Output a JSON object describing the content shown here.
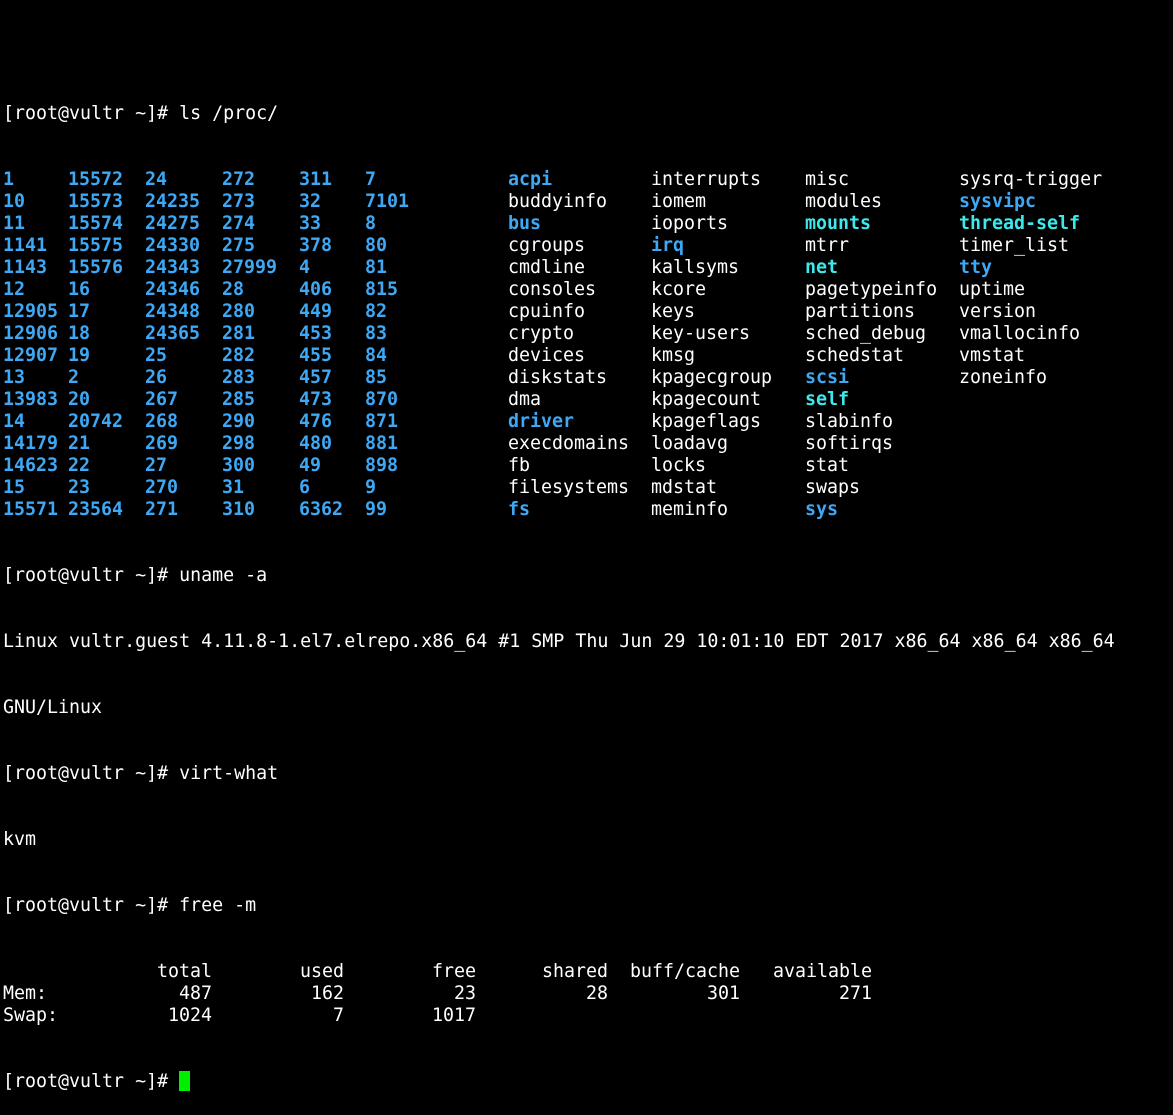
{
  "terminal": {
    "prompt": "[root@vultr ~]# ",
    "cutoff_line": "",
    "commands": {
      "ls": "ls /proc/",
      "uname": "uname -a",
      "virt": "virt-what",
      "free": "free -m"
    },
    "ls_rows": [
      [
        {
          "t": "1",
          "k": "num"
        },
        {
          "t": "15572",
          "k": "num"
        },
        {
          "t": "24",
          "k": "num"
        },
        {
          "t": "272",
          "k": "num"
        },
        {
          "t": "311",
          "k": "num"
        },
        {
          "t": "7",
          "k": "num"
        },
        {
          "t": "acpi",
          "k": "dir"
        },
        {
          "t": "interrupts",
          "k": "file"
        },
        {
          "t": "misc",
          "k": "file"
        },
        {
          "t": "sysrq-trigger",
          "k": "file"
        }
      ],
      [
        {
          "t": "10",
          "k": "num"
        },
        {
          "t": "15573",
          "k": "num"
        },
        {
          "t": "24235",
          "k": "num"
        },
        {
          "t": "273",
          "k": "num"
        },
        {
          "t": "32",
          "k": "num"
        },
        {
          "t": "7101",
          "k": "num"
        },
        {
          "t": "buddyinfo",
          "k": "file"
        },
        {
          "t": "iomem",
          "k": "file"
        },
        {
          "t": "modules",
          "k": "file"
        },
        {
          "t": "sysvipc",
          "k": "dir"
        }
      ],
      [
        {
          "t": "11",
          "k": "num"
        },
        {
          "t": "15574",
          "k": "num"
        },
        {
          "t": "24275",
          "k": "num"
        },
        {
          "t": "274",
          "k": "num"
        },
        {
          "t": "33",
          "k": "num"
        },
        {
          "t": "8",
          "k": "num"
        },
        {
          "t": "bus",
          "k": "dir"
        },
        {
          "t": "ioports",
          "k": "file"
        },
        {
          "t": "mounts",
          "k": "link"
        },
        {
          "t": "thread-self",
          "k": "link"
        }
      ],
      [
        {
          "t": "1141",
          "k": "num"
        },
        {
          "t": "15575",
          "k": "num"
        },
        {
          "t": "24330",
          "k": "num"
        },
        {
          "t": "275",
          "k": "num"
        },
        {
          "t": "378",
          "k": "num"
        },
        {
          "t": "80",
          "k": "num"
        },
        {
          "t": "cgroups",
          "k": "file"
        },
        {
          "t": "irq",
          "k": "dir"
        },
        {
          "t": "mtrr",
          "k": "file"
        },
        {
          "t": "timer_list",
          "k": "file"
        }
      ],
      [
        {
          "t": "1143",
          "k": "num"
        },
        {
          "t": "15576",
          "k": "num"
        },
        {
          "t": "24343",
          "k": "num"
        },
        {
          "t": "27999",
          "k": "num"
        },
        {
          "t": "4",
          "k": "num"
        },
        {
          "t": "81",
          "k": "num"
        },
        {
          "t": "cmdline",
          "k": "file"
        },
        {
          "t": "kallsyms",
          "k": "file"
        },
        {
          "t": "net",
          "k": "link"
        },
        {
          "t": "tty",
          "k": "dir"
        }
      ],
      [
        {
          "t": "12",
          "k": "num"
        },
        {
          "t": "16",
          "k": "num"
        },
        {
          "t": "24346",
          "k": "num"
        },
        {
          "t": "28",
          "k": "num"
        },
        {
          "t": "406",
          "k": "num"
        },
        {
          "t": "815",
          "k": "num"
        },
        {
          "t": "consoles",
          "k": "file"
        },
        {
          "t": "kcore",
          "k": "file"
        },
        {
          "t": "pagetypeinfo",
          "k": "file"
        },
        {
          "t": "uptime",
          "k": "file"
        }
      ],
      [
        {
          "t": "12905",
          "k": "num"
        },
        {
          "t": "17",
          "k": "num"
        },
        {
          "t": "24348",
          "k": "num"
        },
        {
          "t": "280",
          "k": "num"
        },
        {
          "t": "449",
          "k": "num"
        },
        {
          "t": "82",
          "k": "num"
        },
        {
          "t": "cpuinfo",
          "k": "file"
        },
        {
          "t": "keys",
          "k": "file"
        },
        {
          "t": "partitions",
          "k": "file"
        },
        {
          "t": "version",
          "k": "file"
        }
      ],
      [
        {
          "t": "12906",
          "k": "num"
        },
        {
          "t": "18",
          "k": "num"
        },
        {
          "t": "24365",
          "k": "num"
        },
        {
          "t": "281",
          "k": "num"
        },
        {
          "t": "453",
          "k": "num"
        },
        {
          "t": "83",
          "k": "num"
        },
        {
          "t": "crypto",
          "k": "file"
        },
        {
          "t": "key-users",
          "k": "file"
        },
        {
          "t": "sched_debug",
          "k": "file"
        },
        {
          "t": "vmallocinfo",
          "k": "file"
        }
      ],
      [
        {
          "t": "12907",
          "k": "num"
        },
        {
          "t": "19",
          "k": "num"
        },
        {
          "t": "25",
          "k": "num"
        },
        {
          "t": "282",
          "k": "num"
        },
        {
          "t": "455",
          "k": "num"
        },
        {
          "t": "84",
          "k": "num"
        },
        {
          "t": "devices",
          "k": "file"
        },
        {
          "t": "kmsg",
          "k": "file"
        },
        {
          "t": "schedstat",
          "k": "file"
        },
        {
          "t": "vmstat",
          "k": "file"
        }
      ],
      [
        {
          "t": "13",
          "k": "num"
        },
        {
          "t": "2",
          "k": "num"
        },
        {
          "t": "26",
          "k": "num"
        },
        {
          "t": "283",
          "k": "num"
        },
        {
          "t": "457",
          "k": "num"
        },
        {
          "t": "85",
          "k": "num"
        },
        {
          "t": "diskstats",
          "k": "file"
        },
        {
          "t": "kpagecgroup",
          "k": "file"
        },
        {
          "t": "scsi",
          "k": "dir"
        },
        {
          "t": "zoneinfo",
          "k": "file"
        }
      ],
      [
        {
          "t": "13983",
          "k": "num"
        },
        {
          "t": "20",
          "k": "num"
        },
        {
          "t": "267",
          "k": "num"
        },
        {
          "t": "285",
          "k": "num"
        },
        {
          "t": "473",
          "k": "num"
        },
        {
          "t": "870",
          "k": "num"
        },
        {
          "t": "dma",
          "k": "file"
        },
        {
          "t": "kpagecount",
          "k": "file"
        },
        {
          "t": "self",
          "k": "link"
        },
        {
          "t": "",
          "k": "file"
        }
      ],
      [
        {
          "t": "14",
          "k": "num"
        },
        {
          "t": "20742",
          "k": "num"
        },
        {
          "t": "268",
          "k": "num"
        },
        {
          "t": "290",
          "k": "num"
        },
        {
          "t": "476",
          "k": "num"
        },
        {
          "t": "871",
          "k": "num"
        },
        {
          "t": "driver",
          "k": "dir"
        },
        {
          "t": "kpageflags",
          "k": "file"
        },
        {
          "t": "slabinfo",
          "k": "file"
        },
        {
          "t": "",
          "k": "file"
        }
      ],
      [
        {
          "t": "14179",
          "k": "num"
        },
        {
          "t": "21",
          "k": "num"
        },
        {
          "t": "269",
          "k": "num"
        },
        {
          "t": "298",
          "k": "num"
        },
        {
          "t": "480",
          "k": "num"
        },
        {
          "t": "881",
          "k": "num"
        },
        {
          "t": "execdomains",
          "k": "file"
        },
        {
          "t": "loadavg",
          "k": "file"
        },
        {
          "t": "softirqs",
          "k": "file"
        },
        {
          "t": "",
          "k": "file"
        }
      ],
      [
        {
          "t": "14623",
          "k": "num"
        },
        {
          "t": "22",
          "k": "num"
        },
        {
          "t": "27",
          "k": "num"
        },
        {
          "t": "300",
          "k": "num"
        },
        {
          "t": "49",
          "k": "num"
        },
        {
          "t": "898",
          "k": "num"
        },
        {
          "t": "fb",
          "k": "file"
        },
        {
          "t": "locks",
          "k": "file"
        },
        {
          "t": "stat",
          "k": "file"
        },
        {
          "t": "",
          "k": "file"
        }
      ],
      [
        {
          "t": "15",
          "k": "num"
        },
        {
          "t": "23",
          "k": "num"
        },
        {
          "t": "270",
          "k": "num"
        },
        {
          "t": "31",
          "k": "num"
        },
        {
          "t": "6",
          "k": "num"
        },
        {
          "t": "9",
          "k": "num"
        },
        {
          "t": "filesystems",
          "k": "file"
        },
        {
          "t": "mdstat",
          "k": "file"
        },
        {
          "t": "swaps",
          "k": "file"
        },
        {
          "t": "",
          "k": "file"
        }
      ],
      [
        {
          "t": "15571",
          "k": "num"
        },
        {
          "t": "23564",
          "k": "num"
        },
        {
          "t": "271",
          "k": "num"
        },
        {
          "t": "310",
          "k": "num"
        },
        {
          "t": "6362",
          "k": "num"
        },
        {
          "t": "99",
          "k": "num"
        },
        {
          "t": "fs",
          "k": "dir"
        },
        {
          "t": "meminfo",
          "k": "file"
        },
        {
          "t": "sys",
          "k": "dir"
        },
        {
          "t": "",
          "k": "file"
        }
      ]
    ],
    "uname_output": [
      "Linux vultr.guest 4.11.8-1.el7.elrepo.x86_64 #1 SMP Thu Jun 29 10:01:10 EDT 2017 x86_64 x86_64 x86_64",
      "GNU/Linux"
    ],
    "virt_output": "kvm",
    "free": {
      "headers": [
        "",
        "total",
        "used",
        "free",
        "shared",
        "buff/cache",
        "available"
      ],
      "rows": [
        [
          "Mem:",
          "487",
          "162",
          "23",
          "28",
          "301",
          "271"
        ],
        [
          "Swap:",
          "1024",
          "7",
          "1017",
          "",
          "",
          ""
        ]
      ]
    },
    "colors": {
      "background": "#000000",
      "text": "#ffffff",
      "directory": "#3ea8f5",
      "symlink": "#3ee8ec",
      "cursor": "#00ee00"
    }
  }
}
